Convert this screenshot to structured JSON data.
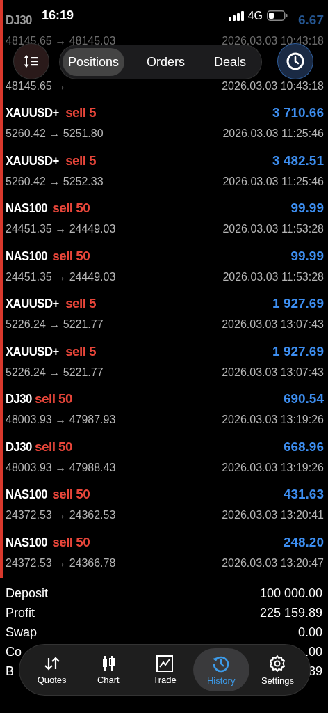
{
  "status_bar": {
    "time": "16:19",
    "network": "4G"
  },
  "filter_tabs": [
    {
      "label": "Positions",
      "selected": true
    },
    {
      "label": "Orders",
      "selected": false
    },
    {
      "label": "Deals",
      "selected": false
    }
  ],
  "deals": [
    {
      "symbol": "DJ30",
      "profit": "6.67",
      "prices": "48145.65 → 48145.03",
      "time": "2026.03.03 10:43:18"
    },
    {
      "prices": "48145.65 →",
      "time": "2026.03.03 10:43:18"
    },
    {
      "symbol": "XAUUSD+",
      "side": "sell 5",
      "kind": "sell",
      "profit": "3 710.66",
      "prices": "5260.42 → 5251.80",
      "time": "2026.03.03 11:25:46"
    },
    {
      "symbol": "XAUUSD+",
      "side": "sell 5",
      "kind": "sell",
      "profit": "3 482.51",
      "prices": "5260.42 → 5252.33",
      "time": "2026.03.03 11:25:46"
    },
    {
      "symbol": "NAS100",
      "side": "sell 50",
      "kind": "sell",
      "profit": "99.99",
      "prices": "24451.35 → 24449.03",
      "time": "2026.03.03 11:53:28"
    },
    {
      "symbol": "NAS100",
      "side": "sell 50",
      "kind": "sell",
      "profit": "99.99",
      "prices": "24451.35 → 24449.03",
      "time": "2026.03.03 11:53:28"
    },
    {
      "symbol": "XAUUSD+",
      "side": "sell 5",
      "kind": "sell",
      "profit": "1 927.69",
      "prices": "5226.24 → 5221.77",
      "time": "2026.03.03 13:07:43"
    },
    {
      "symbol": "XAUUSD+",
      "side": "sell 5",
      "kind": "sell",
      "profit": "1 927.69",
      "prices": "5226.24 → 5221.77",
      "time": "2026.03.03 13:07:43"
    },
    {
      "symbol": "DJ30",
      "side": "sell 50",
      "kind": "sell",
      "profit": "690.54",
      "prices": "48003.93 → 47987.93",
      "time": "2026.03.03 13:19:26"
    },
    {
      "symbol": "DJ30",
      "side": "sell 50",
      "kind": "sell",
      "profit": "668.96",
      "prices": "48003.93 → 47988.43",
      "time": "2026.03.03 13:19:26"
    },
    {
      "symbol": "NAS100",
      "side": "sell 50",
      "kind": "sell",
      "profit": "431.63",
      "prices": "24372.53 → 24362.53",
      "time": "2026.03.03 13:20:41"
    },
    {
      "symbol": "NAS100",
      "side": "sell 50",
      "kind": "sell",
      "profit": "248.20",
      "prices": "24372.53 → 24366.78",
      "time": "2026.03.03 13:20:47"
    }
  ],
  "summary": [
    {
      "label": "Deposit",
      "value": "100 000.00"
    },
    {
      "label": "Profit",
      "value": "225 159.89"
    },
    {
      "label": "Swap",
      "value": "0.00"
    },
    {
      "label": "Co",
      "value": ".00"
    },
    {
      "label": "B",
      "value": "89"
    }
  ],
  "bottom_tabs": [
    {
      "label": "Quotes",
      "selected": false
    },
    {
      "label": "Chart",
      "selected": false
    },
    {
      "label": "Trade",
      "selected": false
    },
    {
      "label": "History",
      "selected": true
    },
    {
      "label": "Settings",
      "selected": false
    }
  ]
}
